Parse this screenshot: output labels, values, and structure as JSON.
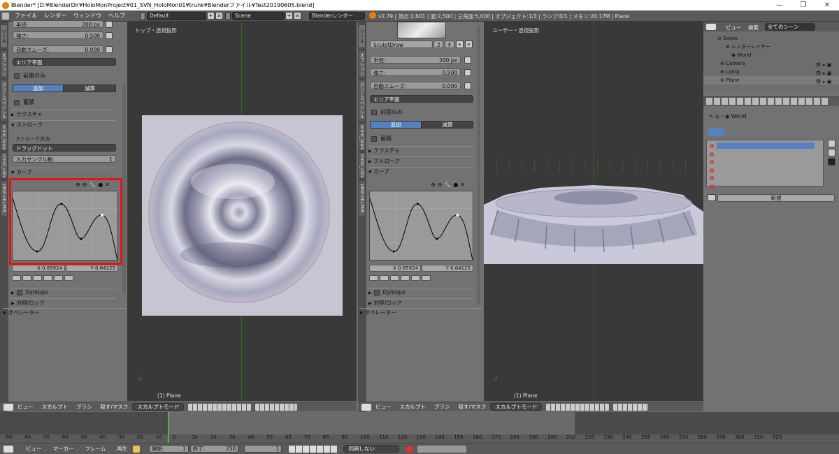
{
  "window": {
    "title": "Blender* [D:¥BlenderDir¥HoloMonProject¥01_SVN_HoloMon01¥trunk¥Blenderファイル¥Test20190605.blend]"
  },
  "info": {
    "menus": [
      "ファイル",
      "レンダー",
      "ウィンドウ",
      "ヘルプ"
    ],
    "layout": "Default",
    "scene": "Scene",
    "engine": "Blenderレンダー",
    "stats": "v2.79 | 頂点:2,601 | 面:2,500 | 三角面:5,000 | オブジェクト:1/3 | ランプ:0/1 | メモリ:20.17M | Plane"
  },
  "left_tabs": [
    "ツール",
    "オプション",
    "グリースペンシル",
    "mmd_tools",
    "mmd_utils",
    "VRM HELPER"
  ],
  "left_panel": {
    "radius_label": "半径:",
    "radius_value": "200 px",
    "strength_label": "強さ:",
    "strength_value": "0.500",
    "autosmooth_label": "自動スムーズ:",
    "autosmooth_value": "0.000",
    "area_plane": "エリア平面",
    "front_only": "前面のみ",
    "add": "追加",
    "subtract": "減算",
    "accumulate": "蓄積",
    "texture": "テクスチャ",
    "stroke": "ストローク",
    "stroke_method_label": "ストローク方法:",
    "stroke_method": "ドラッグドット",
    "input_samples_label": "入力サンプル数:",
    "input_samples": "1",
    "curve": "カーブ",
    "x_value": "X 0.85924",
    "y_value": "Y 0.64125",
    "dyntopo": "Dyntopo",
    "symmetry": "対称/ロック",
    "operator": "オペレーター"
  },
  "mid_tabs": [
    "ツール",
    "オプション",
    "グリースペンシル",
    "mmd_tools",
    "mmd_utils",
    "VRM HELPER"
  ],
  "mid_panel": {
    "brush_name": "SculptDraw",
    "brush_users": "2",
    "brush_f": "F",
    "radius_label": "半径:",
    "radius_value": "200 px",
    "strength_label": "強さ:",
    "strength_value": "0.500",
    "autosmooth_label": "自動スムーズ:",
    "autosmooth_value": "0.000",
    "area_plane": "エリア平面",
    "front_only": "前面のみ",
    "add": "追加",
    "subtract": "減算",
    "accumulate": "蓄積",
    "texture": "テクスチャ",
    "stroke": "ストローク",
    "curve": "カーブ",
    "x_value": "X 0.85924",
    "y_value": "Y 0.64125",
    "dyntopo": "Dyntopo",
    "symmetry": "対称/ロック",
    "operator": "オペレーター"
  },
  "viewport_left": {
    "title": "トップ・透視投影",
    "object": "(1) Plane"
  },
  "viewport_right": {
    "title": "ユーザー・透視投影",
    "object": "(1) Plane"
  },
  "header3d": {
    "view": "ビュー",
    "sculpt": "スカルプト",
    "brush": "ブラシ",
    "hide_mask": "隠す/マスク",
    "mode": "スカルプトモード"
  },
  "outliner": {
    "view": "ビュー",
    "search": "検索",
    "filter": "全てのシーン",
    "items": [
      "Scene",
      "レンダーレイヤー",
      "World",
      "Camera",
      "Lamp",
      "Plane"
    ]
  },
  "properties": {
    "world": "World",
    "new_button": "新規"
  },
  "timeline": {
    "ticks": [
      "-90",
      "-80",
      "-70",
      "-60",
      "-50",
      "-40",
      "-30",
      "-20",
      "-10",
      "0",
      "10",
      "20",
      "30",
      "40",
      "50",
      "60",
      "70",
      "80",
      "90",
      "100",
      "110",
      "120",
      "130",
      "140",
      "150",
      "160",
      "170",
      "180",
      "190",
      "200",
      "210",
      "220",
      "230",
      "240",
      "250",
      "260",
      "270",
      "280",
      "290",
      "300",
      "310",
      "320"
    ],
    "view": "ビュー",
    "marker": "マーカー",
    "frame": "フレーム",
    "playback": "再生",
    "start_label": "開始:",
    "start": "1",
    "end_label": "終了:",
    "end": "250",
    "current": "1",
    "sync": "同期しない"
  },
  "colors": {
    "accent": "#5680c2",
    "highlight": "#e0161a",
    "mesh": "#c9c9d9"
  }
}
